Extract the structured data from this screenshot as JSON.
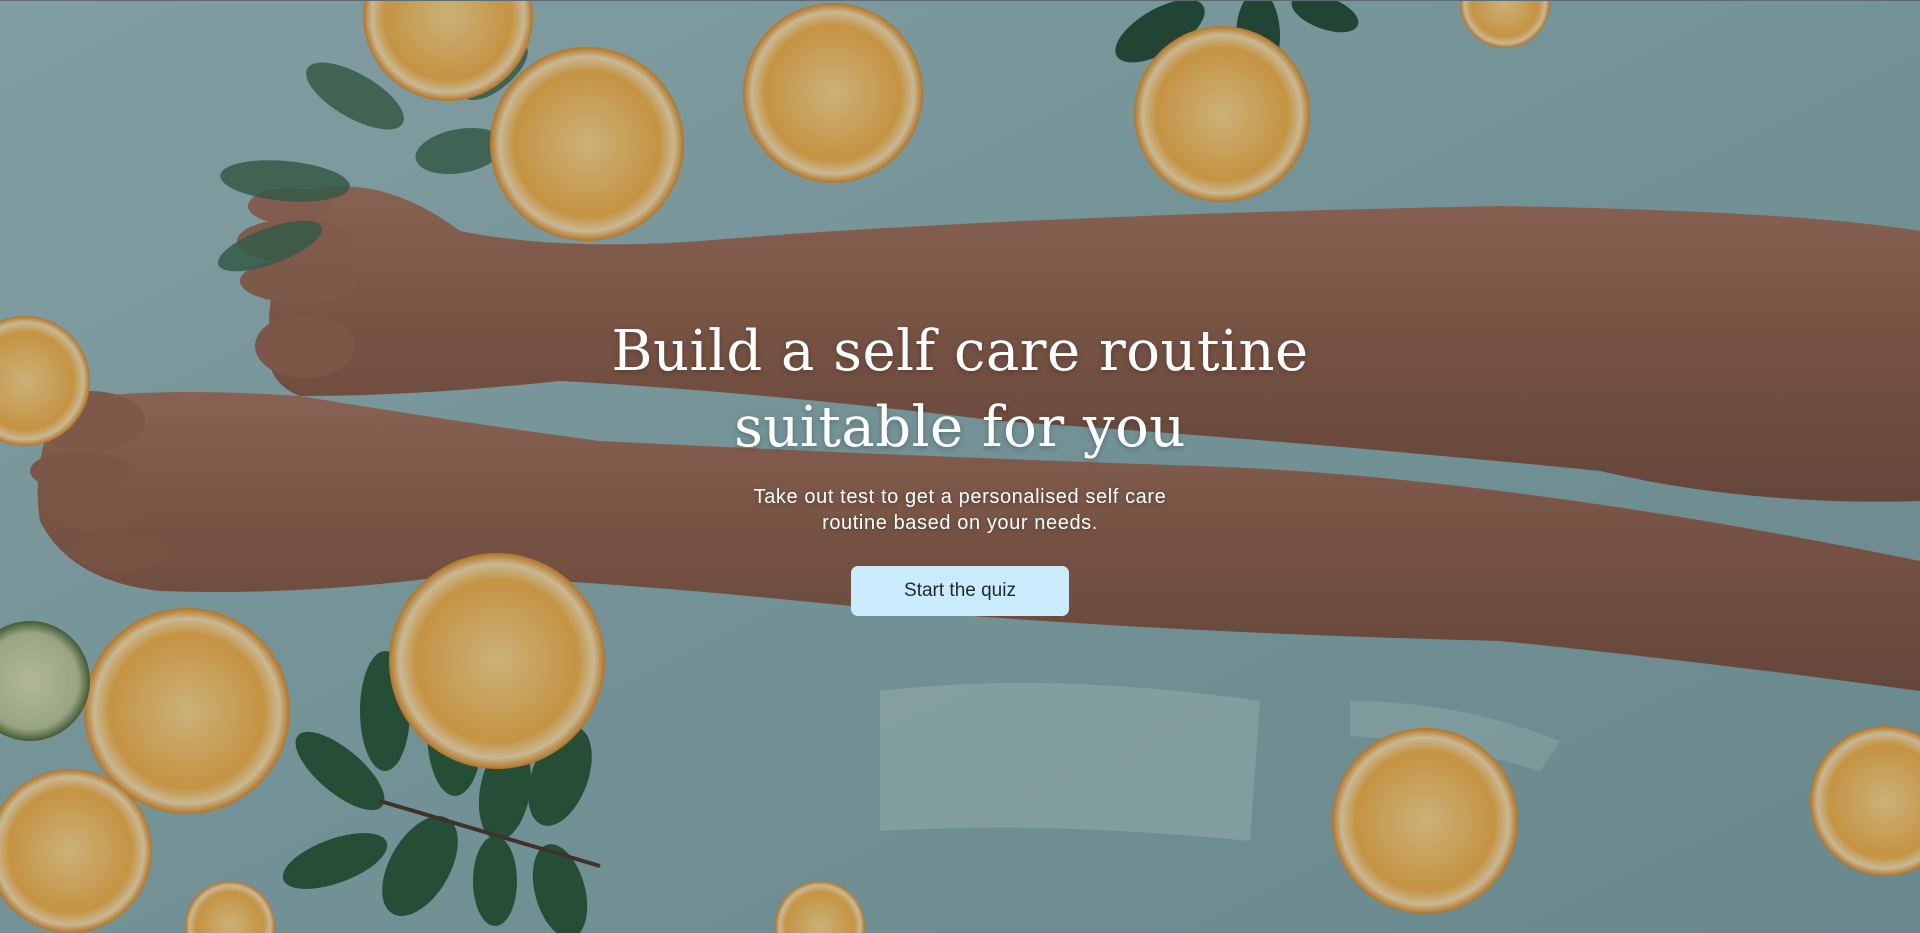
{
  "hero": {
    "headline_line1": "Build a self care routine",
    "headline_line2": "suitable for you",
    "subtext_line1": "Take out test to get a personalised self care",
    "subtext_line2": "routine based on your needs.",
    "cta_label": "Start the quiz",
    "cta_color": "#c9ebfb",
    "background_image": "legs-in-bath-with-orange-slices-photo"
  }
}
